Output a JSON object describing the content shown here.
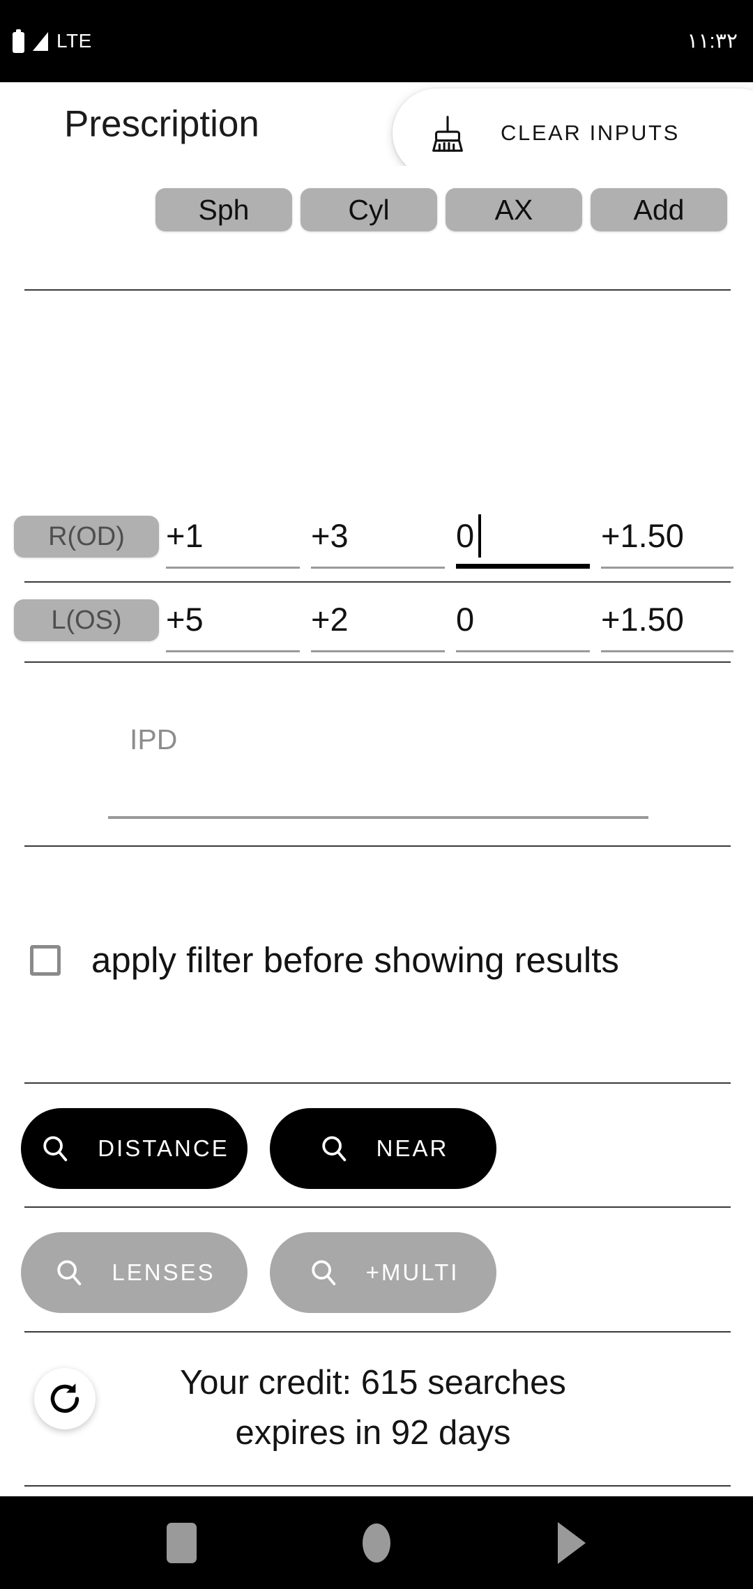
{
  "status_bar": {
    "network": "LTE",
    "time": "١١:٣٢",
    "battery_icon": "battery-icon",
    "signal_icon": "signal-icon"
  },
  "header": {
    "title": "Prescription",
    "clear_button": {
      "label": "CLEAR INPUTS",
      "icon": "broom-icon"
    }
  },
  "prescription_table": {
    "column_headers": [
      "Sph",
      "Cyl",
      "AX",
      "Add"
    ],
    "rows": [
      {
        "eye_label": "R(OD)",
        "values": [
          "+1",
          "+3",
          "0",
          "+1.50"
        ],
        "focused_index": 2
      },
      {
        "eye_label": "L(OS)",
        "values": [
          "+5",
          "+2",
          "0",
          "+1.50"
        ],
        "focused_index": -1
      }
    ]
  },
  "ipd": {
    "placeholder": "IPD",
    "value": ""
  },
  "filter": {
    "label": "apply filter before showing results",
    "checked": false
  },
  "actions": {
    "distance": {
      "label": "DISTANCE",
      "icon": "search-icon",
      "enabled": true
    },
    "near": {
      "label": "NEAR",
      "icon": "search-icon",
      "enabled": true
    },
    "lenses": {
      "label": "LENSES",
      "icon": "search-icon",
      "enabled": false
    },
    "multi": {
      "label": "+MULTI",
      "icon": "search-icon",
      "enabled": false
    }
  },
  "credit": {
    "line1": "Your credit: 615 searches",
    "line2": "expires in 92 days",
    "refresh_icon": "refresh-icon"
  },
  "nav_bar": {
    "recents": "square-icon",
    "home": "circle-icon",
    "back": "triangle-icon"
  },
  "colors": {
    "chip_gray": "#b0b0b0",
    "pill_dark": "#000000",
    "pill_muted": "#a8a8a8",
    "focus_underline": "#000000",
    "idle_underline": "#9a9a9a"
  }
}
